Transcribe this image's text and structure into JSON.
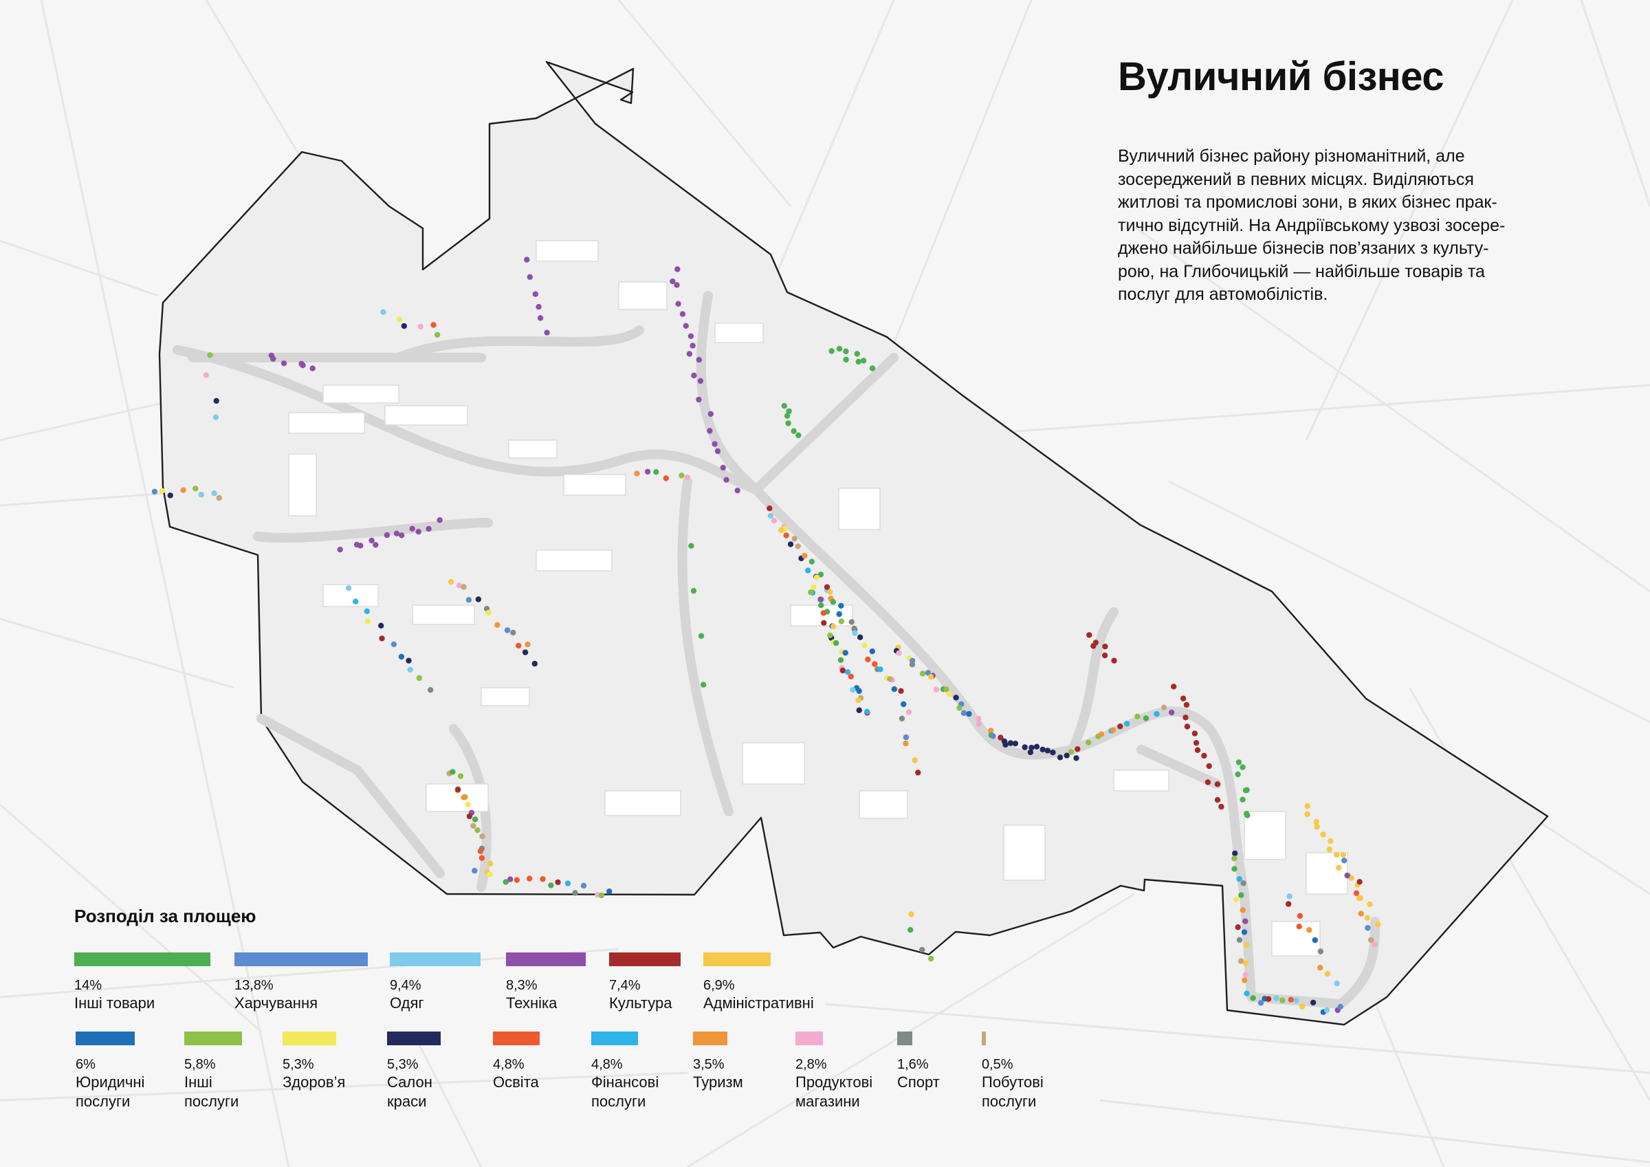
{
  "title": "Вуличний бізнес",
  "intro": "Вуличний бізнес району різноманітний, але\nзосереджений в певних місцях. Виділяються\nжитлові та промислові зони, в яких бізнес прак-\nтично відсутній. На Андріївському узвозі зосере-\nджено найбільше бізнесів пов’язаних з культу-\nрою, на Глибочицькій — найбільше товарів та\nпослуг для автомобілістів.",
  "legend": {
    "title": "Розподіл за площею",
    "items": [
      {
        "pct": "14%",
        "label": "Інші товари",
        "color": "#4caf50"
      },
      {
        "pct": "13,8%",
        "label": "Харчування",
        "color": "#5b8bd0"
      },
      {
        "pct": "9,4%",
        "label": "Одяг",
        "color": "#7fcbee"
      },
      {
        "pct": "8,3%",
        "label": "Техніка",
        "color": "#8e4fa8"
      },
      {
        "pct": "7,4%",
        "label": "Культура",
        "color": "#a52a2a"
      },
      {
        "pct": "6,9%",
        "label": "Адміністративні",
        "color": "#f7c948"
      },
      {
        "pct": "6%",
        "label": "Юридичні\nпослуги",
        "color": "#1f6fb8"
      },
      {
        "pct": "5,8%",
        "label": "Інші\nпослуги",
        "color": "#8dc14a"
      },
      {
        "pct": "5,3%",
        "label": "Здоров’я",
        "color": "#f3e85a"
      },
      {
        "pct": "5,3%",
        "label": "Салон\nкраси",
        "color": "#232a5e"
      },
      {
        "pct": "4,8%",
        "label": "Освіта",
        "color": "#ec5a30"
      },
      {
        "pct": "4,8%",
        "label": "Фінансові\nпослуги",
        "color": "#2fb3e8"
      },
      {
        "pct": "3,5%",
        "label": "Туризм",
        "color": "#f0963a"
      },
      {
        "pct": "2,8%",
        "label": "Продуктові\nмагазини",
        "color": "#f3acd0"
      },
      {
        "pct": "1,6%",
        "label": "Спорт",
        "color": "#7e8a86"
      },
      {
        "pct": "0,5%",
        "label": "Побутові\nпослуги",
        "color": "#c8a57a"
      }
    ]
  }
}
